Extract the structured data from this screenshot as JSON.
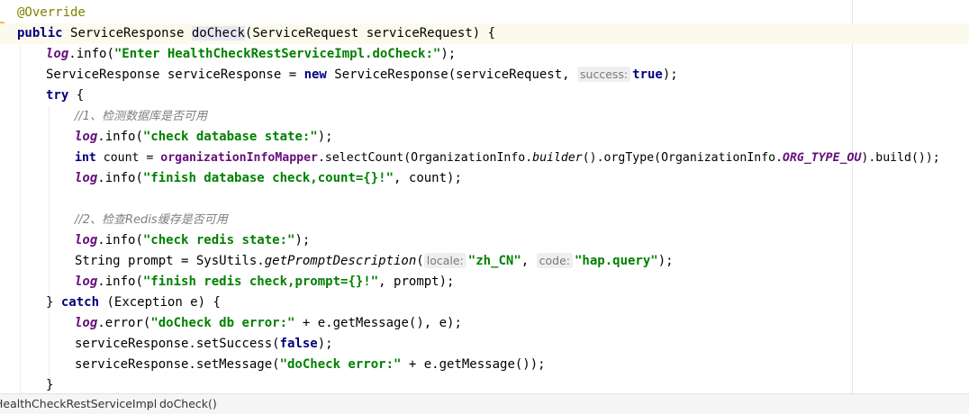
{
  "code": {
    "annotation": "@Override",
    "kw_public": "public",
    "sig_type": "ServiceResponse ",
    "method_name": "doCheck",
    "sig_params": "(ServiceRequest serviceRequest) {",
    "log_var": "log",
    "l3_info": ".info(",
    "l3_str": "\"Enter HealthCheckRestServiceImpl.doCheck:\"",
    "end_paren_semi": ");",
    "l4_decl": "ServiceResponse serviceResponse = ",
    "kw_new": "new",
    "l4_ctor": " ServiceResponse(serviceRequest, ",
    "hint_success": "success:",
    "kw_true": "true",
    "kw_try": "try",
    "l5_rest": " {",
    "comment1": "//1、检测数据库是否可用",
    "l7_str": "\"check database state:\"",
    "kw_int": "int",
    "l8_a": " count = ",
    "l8_mapper": "organizationInfoMapper",
    "l8_b": ".selectCount(OrganizationInfo.",
    "l8_builder": "builder",
    "l8_c": "().orgType(OrganizationInfo.",
    "l8_const": "ORG_TYPE_OU",
    "l8_d": ").build());",
    "l9_str": "\"finish database check,count={}!\"",
    "l9_rest": ", count);",
    "comment2": "//2、检查Redis缓存是否可用",
    "l12_str": "\"check redis state:\"",
    "l13_a": "String prompt = SysUtils.",
    "l13_method": "getPromptDescription",
    "paren_open": "(",
    "hint_locale": "locale:",
    "l13_str1": "\"zh_CN\"",
    "comma_space": ", ",
    "hint_code": "code:",
    "l13_str2": "\"hap.query\"",
    "l14_str": "\"finish redis check,prompt={}!\"",
    "l14_rest": ", prompt);",
    "brace_close": "}",
    "kw_catch": "catch",
    "l15_rest": " (Exception e) {",
    "l16_error": ".error(",
    "l16_str": "\"doCheck db error:\"",
    "l16_rest": " + e.getMessage(), e);",
    "l17_a": "serviceResponse.setSuccess(",
    "kw_false": "false",
    "l18_a": "serviceResponse.setMessage(",
    "l18_str": "\"doCheck error:\"",
    "l18_rest": " + e.getMessage());"
  },
  "breadcrumb": {
    "class_name": "HealthCheckRestServiceImpl",
    "separator": "›",
    "method": "doCheck()"
  },
  "colors": {
    "keyword": "#000080",
    "string": "#008000",
    "field": "#660e7a",
    "comment": "#808080",
    "annotation": "#808000",
    "current_line": "#fcfaed"
  }
}
